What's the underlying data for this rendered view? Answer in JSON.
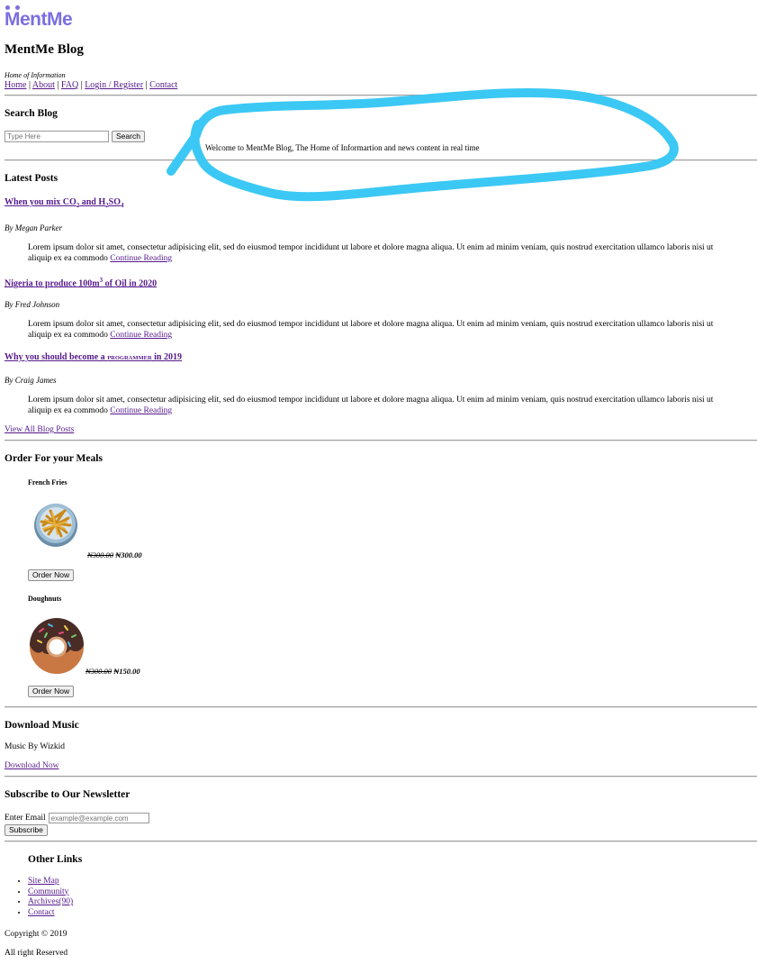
{
  "brand": {
    "logo_text": "MentMe",
    "logo_color": "#7b6fe0"
  },
  "header": {
    "title": "MentMe Blog",
    "tagline": "Home of Information",
    "nav": [
      "Home",
      "About",
      "FAQ",
      "Login / Register",
      "Contact"
    ]
  },
  "search": {
    "heading": "Search Blog",
    "placeholder": "Type Here",
    "button_label": "Search",
    "welcome_text": "Welcome to MentMe Blog, The Home of Informartion and news content in real time"
  },
  "annotation": {
    "scribble_color": "#3cc8f4"
  },
  "posts": {
    "heading": "Latest Posts",
    "items": [
      {
        "title": "When you mix CO2 and H2SO4",
        "title_parts": [
          "When you mix CO",
          "2",
          " and H",
          "2",
          "SO",
          "4"
        ],
        "author": "By Megan Parker",
        "body": "Lorem ipsum dolor sit amet, consectetur adipisicing elit, sed do eiusmod tempor incididunt ut labore et dolore magna aliqua. Ut enim ad minim veniam, quis nostrud exercitation ullamco laboris nisi ut aliquip ex ea commodo",
        "link": "Continue Reading"
      },
      {
        "title": "Nigeria to produce 100m3 of Oil in 2020",
        "title_parts": [
          "Nigeria to produce 100m",
          "3",
          " of Oil in 2020"
        ],
        "author": "By Fred Johnson",
        "body": "Lorem ipsum dolor sit amet, consectetur adipisicing elit, sed do eiusmod tempor incididunt ut labore et dolore magna aliqua. Ut enim ad minim veniam, quis nostrud exercitation ullamco laboris nisi ut aliquip ex ea commodo",
        "link": "Continue Reading"
      },
      {
        "title": "Why you should become a PROGRAMMER in 2019",
        "title_parts": [
          "Why you should become a ",
          "PROGRAMMER",
          " in 2019"
        ],
        "author": "By Craig James",
        "body": "Lorem ipsum dolor sit amet, consectetur adipisicing elit, sed do eiusmod tempor incididunt ut labore et dolore magna aliqua. Ut enim ad minim veniam, quis nostrud exercitation ullamco laboris nisi ut aliquip ex ea commodo",
        "link": "Continue Reading"
      }
    ],
    "view_all": "View All Blog Posts"
  },
  "meals": {
    "heading": "Order For your Meals",
    "items": [
      {
        "name": "French Fries",
        "old_price": "₦300.00",
        "new_price": "₦300.00",
        "button": "Order Now",
        "icon": "french-fries-image"
      },
      {
        "name": "Doughnuts",
        "old_price": "₦300.00",
        "new_price": "₦150.00",
        "button": "Order Now",
        "icon": "doughnut-image"
      }
    ]
  },
  "music": {
    "heading": "Download Music",
    "text": "Music By Wizkid",
    "link": "Download Now"
  },
  "newsletter": {
    "heading": "Subscribe to Our Newsletter",
    "label": "Enter Email",
    "placeholder": "example@example.com",
    "button": "Subscribe"
  },
  "footer": {
    "heading": "Other Links",
    "links": [
      "Site Map",
      "Community",
      "Archives(90)",
      "Contact"
    ],
    "copyright": "Copyright © 2019",
    "rights": "All right Reserved"
  }
}
